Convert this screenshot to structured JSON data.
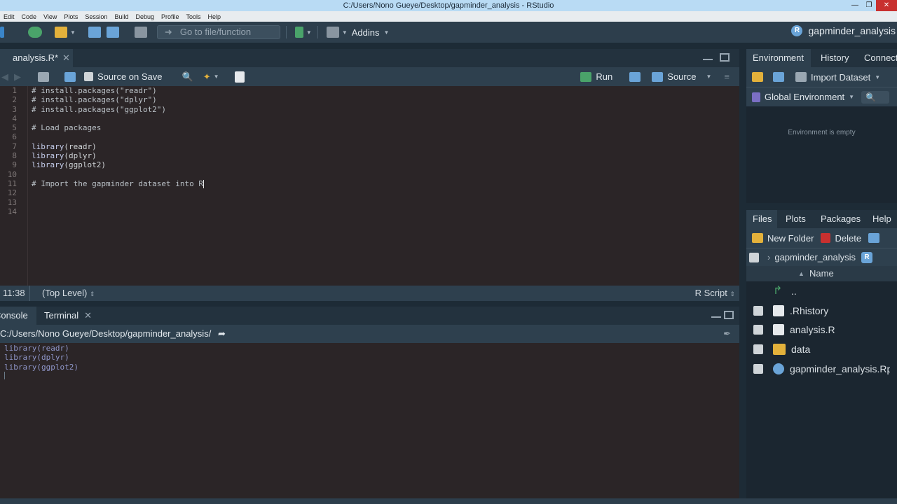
{
  "window": {
    "title": "C:/Users/Nono Gueye/Desktop/gapminder_analysis - RStudio"
  },
  "menu": [
    "Edit",
    "Code",
    "View",
    "Plots",
    "Session",
    "Build",
    "Debug",
    "Profile",
    "Tools",
    "Help"
  ],
  "toolbar": {
    "goto_placeholder": "Go to file/function",
    "addins_label": "Addins",
    "project_label": "gapminder_analysis"
  },
  "editor": {
    "tab_label": "analysis.R*",
    "source_on_save": "Source on Save",
    "run_label": "Run",
    "source_label": "Source",
    "line_numbers": [
      "1",
      "2",
      "3",
      "4",
      "5",
      "6",
      "7",
      "8",
      "9",
      "10",
      "11",
      "12",
      "13",
      "14"
    ],
    "status": {
      "position": "11:38",
      "scope": "(Top Level)",
      "file_type": "R Script"
    }
  },
  "console": {
    "tabs": [
      "Console",
      "Terminal"
    ],
    "path": "C:/Users/Nono Gueye/Desktop/gapminder_analysis/",
    "lines": [
      "library(readr)",
      "library(dplyr)",
      "library(ggplot2)"
    ]
  },
  "environment": {
    "tabs": [
      "Environment",
      "History",
      "Connections"
    ],
    "import_label": "Import Dataset",
    "scope_label": "Global Environment",
    "empty_text": "Environment is empty"
  },
  "files": {
    "tabs": [
      "Files",
      "Plots",
      "Packages",
      "Help"
    ],
    "new_folder": "New Folder",
    "delete": "Delete",
    "crumb": "gapminder_analysis",
    "name_header": "Name",
    "items": [
      "..",
      ".Rhistory",
      "analysis.R",
      "data",
      "gapminder_analysis.Rproj"
    ]
  },
  "colors": {
    "accent": "#6aa4d8",
    "background": "#2b2527",
    "chrome": "#2e404e"
  }
}
